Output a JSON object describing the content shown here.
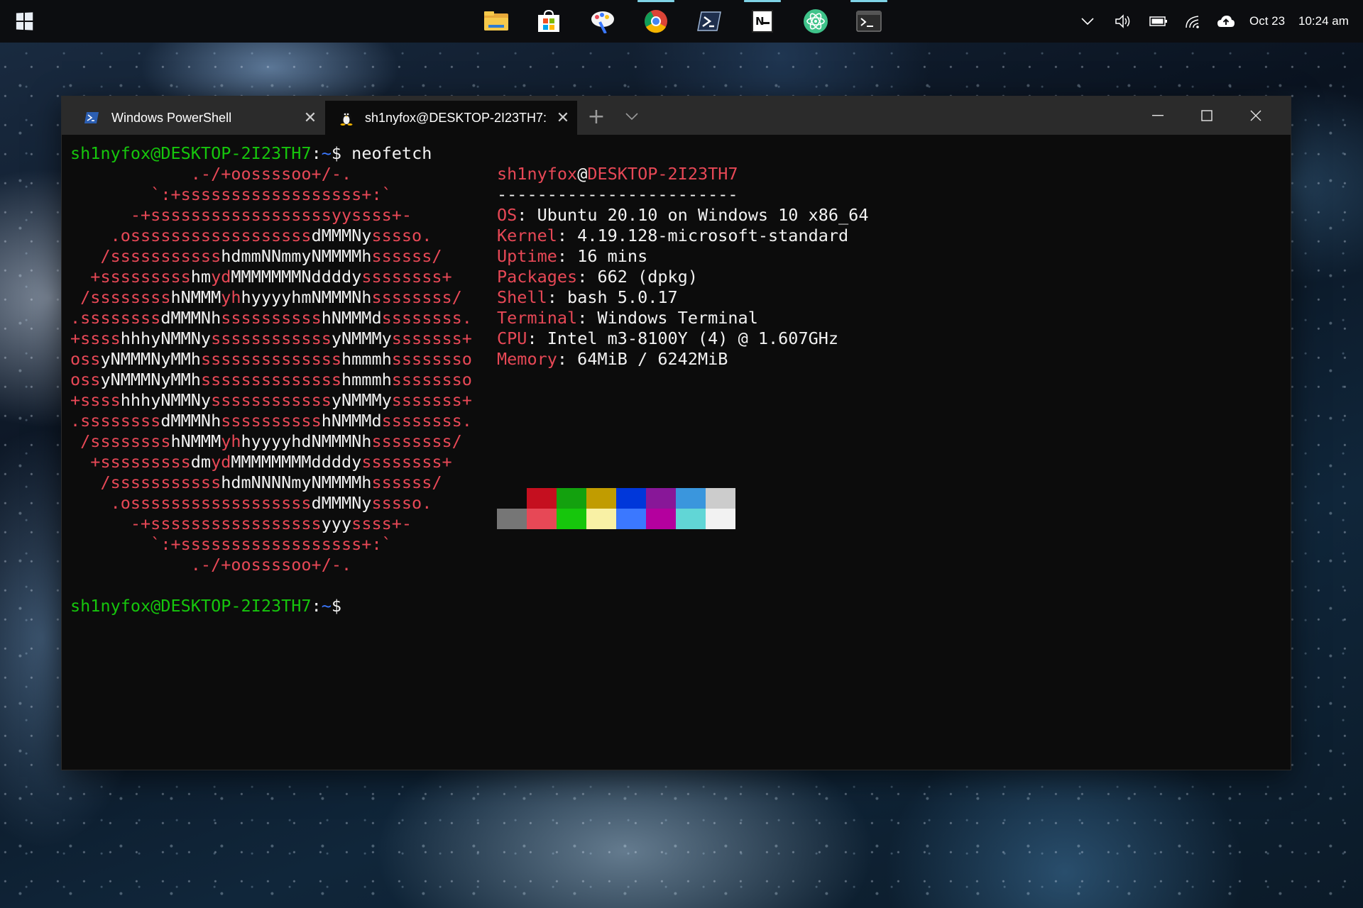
{
  "taskbar": {
    "apps": [
      {
        "name": "file-explorer",
        "color": "#f6c94b"
      },
      {
        "name": "microsoft-store",
        "color": "#ffffff"
      },
      {
        "name": "paint",
        "color": "#ffffff"
      },
      {
        "name": "chrome",
        "color": "#4caf50"
      },
      {
        "name": "powershell",
        "color": "#ffffff"
      },
      {
        "name": "notion",
        "color": "#ffffff"
      },
      {
        "name": "atom",
        "color": "#3fc38a"
      },
      {
        "name": "windows-terminal",
        "color": "#ffffff"
      }
    ],
    "date": "Oct 23",
    "time": "10:24 am"
  },
  "window": {
    "tabs": [
      {
        "label": "Windows PowerShell",
        "icon": "powershell-icon",
        "active": false
      },
      {
        "label": "sh1nyfox@DESKTOP-2I23TH7: ~",
        "icon": "linux-penguin-icon",
        "active": true
      }
    ],
    "new_tab": "+"
  },
  "terminal": {
    "prompt_user_host": "sh1nyfox@DESKTOP-2I23TH7",
    "prompt_colon": ":",
    "prompt_path": "~",
    "prompt_dollar": "$",
    "command": " neofetch",
    "logo_lines": [
      [
        [
          "r",
          "            .-/+oossssoo+/-.               "
        ]
      ],
      [
        [
          "r",
          "        `:+ssssssssssssssssss+:`           "
        ]
      ],
      [
        [
          "r",
          "      -+ssssssssssssssssssyyssss+-         "
        ]
      ],
      [
        [
          "r",
          "    .ossssssssssssssssss"
        ],
        [
          "w",
          "dMMMNy"
        ],
        [
          "r",
          "sssso.       "
        ]
      ],
      [
        [
          "r",
          "   /sssssssssss"
        ],
        [
          "w",
          "hdmmNNmmyNMMMMh"
        ],
        [
          "r",
          "ssssss/      "
        ]
      ],
      [
        [
          "r",
          "  +sssssssss"
        ],
        [
          "w",
          "hm"
        ],
        [
          "r",
          "yd"
        ],
        [
          "w",
          "MMMMMMMNddddy"
        ],
        [
          "r",
          "ssssssss+     "
        ]
      ],
      [
        [
          "r",
          " /ssssssss"
        ],
        [
          "w",
          "hNMMM"
        ],
        [
          "r",
          "yh"
        ],
        [
          "w",
          "hyyyyhmNMMMNh"
        ],
        [
          "r",
          "ssssssss/    "
        ]
      ],
      [
        [
          "r",
          ".ssssssss"
        ],
        [
          "w",
          "dMMMNh"
        ],
        [
          "r",
          "ssssssssss"
        ],
        [
          "w",
          "hNMMMd"
        ],
        [
          "r",
          "ssssssss.   "
        ]
      ],
      [
        [
          "r",
          "+ssss"
        ],
        [
          "w",
          "hhhyNMMNy"
        ],
        [
          "r",
          "ssssssssssss"
        ],
        [
          "w",
          "yNMMMy"
        ],
        [
          "r",
          "sssssss+   "
        ]
      ],
      [
        [
          "r",
          "oss"
        ],
        [
          "w",
          "yNMMMNyMMh"
        ],
        [
          "r",
          "ssssssssssssss"
        ],
        [
          "w",
          "hmmmh"
        ],
        [
          "r",
          "ssssssso   "
        ]
      ],
      [
        [
          "r",
          "oss"
        ],
        [
          "w",
          "yNMMMNyMMh"
        ],
        [
          "r",
          "ssssssssssssss"
        ],
        [
          "w",
          "hmmmh"
        ],
        [
          "r",
          "ssssssso   "
        ]
      ],
      [
        [
          "r",
          "+ssss"
        ],
        [
          "w",
          "hhhyNMMNy"
        ],
        [
          "r",
          "ssssssssssss"
        ],
        [
          "w",
          "yNMMMy"
        ],
        [
          "r",
          "sssssss+   "
        ]
      ],
      [
        [
          "r",
          ".ssssssss"
        ],
        [
          "w",
          "dMMMNh"
        ],
        [
          "r",
          "ssssssssss"
        ],
        [
          "w",
          "hNMMMd"
        ],
        [
          "r",
          "ssssssss.   "
        ]
      ],
      [
        [
          "r",
          " /ssssssss"
        ],
        [
          "w",
          "hNMMM"
        ],
        [
          "r",
          "yh"
        ],
        [
          "w",
          "hyyyyhdNMMMNh"
        ],
        [
          "r",
          "ssssssss/    "
        ]
      ],
      [
        [
          "r",
          "  +sssssssss"
        ],
        [
          "w",
          "dm"
        ],
        [
          "r",
          "yd"
        ],
        [
          "w",
          "MMMMMMMMddddy"
        ],
        [
          "r",
          "ssssssss+     "
        ]
      ],
      [
        [
          "r",
          "   /sssssssssss"
        ],
        [
          "w",
          "hdmNNNNmyNMMMMh"
        ],
        [
          "r",
          "ssssss/      "
        ]
      ],
      [
        [
          "r",
          "    .ossssssssssssssssss"
        ],
        [
          "w",
          "dMMMNy"
        ],
        [
          "r",
          "sssso.       "
        ]
      ],
      [
        [
          "r",
          "      -+sssssssssssssssss"
        ],
        [
          "w",
          "yyy"
        ],
        [
          "r",
          "ssss+-         "
        ]
      ],
      [
        [
          "r",
          "        `:+ssssssssssssssssss+:`           "
        ]
      ],
      [
        [
          "r",
          "            .-/+oossssoo+/-.               "
        ]
      ]
    ],
    "info_user": "sh1nyfox",
    "info_at": "@",
    "info_host": "DESKTOP-2I23TH7",
    "info_separator": "------------------------",
    "info": [
      {
        "key": "OS",
        "value": ": Ubuntu 20.10 on Windows 10 x86_64"
      },
      {
        "key": "Kernel",
        "value": ": 4.19.128-microsoft-standard"
      },
      {
        "key": "Uptime",
        "value": ": 16 mins"
      },
      {
        "key": "Packages",
        "value": ": 662 (dpkg)"
      },
      {
        "key": "Shell",
        "value": ": bash 5.0.17"
      },
      {
        "key": "Terminal",
        "value": ": Windows Terminal"
      },
      {
        "key": "CPU",
        "value": ": Intel m3-8100Y (4) @ 1.607GHz"
      },
      {
        "key": "Memory",
        "value": ": 64MiB / 6242MiB"
      }
    ],
    "palette_top": [
      "#0c0c0c",
      "#c50f1f",
      "#13a10e",
      "#c19c00",
      "#0037da",
      "#881798",
      "#3a96dd",
      "#cccccc"
    ],
    "palette_bottom": [
      "#767676",
      "#e74856",
      "#16c60c",
      "#f9f1a5",
      "#3b78ff",
      "#b4009e",
      "#61d6d6",
      "#f2f2f2"
    ]
  }
}
